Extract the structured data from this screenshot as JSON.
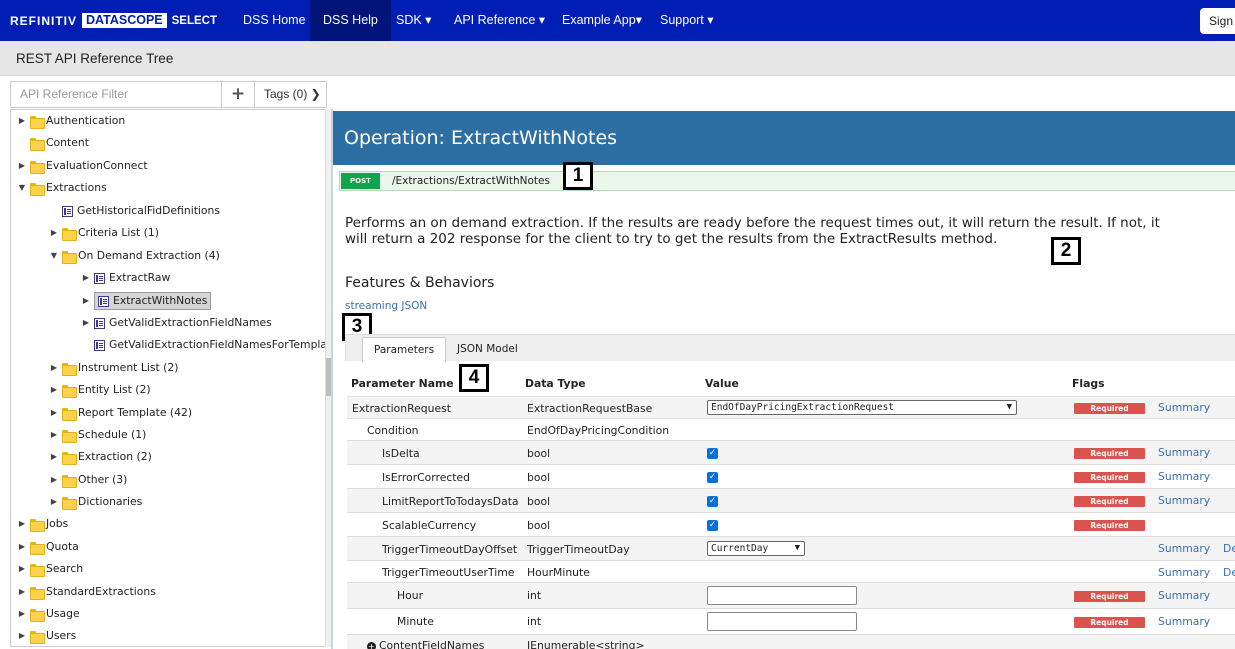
{
  "nav": {
    "logo": {
      "refinitiv": "REFINITIV",
      "datascope": "DATASCOPE",
      "select": "SELECT"
    },
    "items": [
      {
        "label": "DSS Home"
      },
      {
        "label": "DSS Help"
      },
      {
        "label": "SDK ▾"
      },
      {
        "label": "API Reference ▾"
      },
      {
        "label": "Example App▾"
      },
      {
        "label": "Support ▾"
      }
    ],
    "signin": "Sign"
  },
  "header": {
    "title": "REST API Reference Tree"
  },
  "filter": {
    "placeholder": "API Reference Filter",
    "plus": "+",
    "tags": "Tags (0) ❯"
  },
  "tree": [
    {
      "label": "Authentication",
      "arrow": "▶",
      "icon": "folder"
    },
    {
      "label": "Content",
      "arrow": "",
      "icon": "folder"
    },
    {
      "label": "EvaluationConnect",
      "arrow": "▶",
      "icon": "folder"
    },
    {
      "label": "Extractions",
      "arrow": "▼",
      "icon": "folder"
    },
    {
      "label": "GetHistoricalFidDefinitions",
      "arrow": "",
      "icon": "operation"
    },
    {
      "label": "Criteria List (1)",
      "arrow": "▶",
      "icon": "folder"
    },
    {
      "label": "On Demand Extraction (4)",
      "arrow": "▼",
      "icon": "folder"
    },
    {
      "label": "ExtractRaw",
      "arrow": "▶",
      "icon": "operation"
    },
    {
      "label": "ExtractWithNotes",
      "arrow": "▶",
      "icon": "operation"
    },
    {
      "label": "GetValidExtractionFieldNames",
      "arrow": "▶",
      "icon": "operation"
    },
    {
      "label": "GetValidExtractionFieldNamesForTemplat",
      "arrow": "",
      "icon": "operation"
    },
    {
      "label": "Instrument List (2)",
      "arrow": "▶",
      "icon": "folder"
    },
    {
      "label": "Entity List (2)",
      "arrow": "▶",
      "icon": "folder"
    },
    {
      "label": "Report Template (42)",
      "arrow": "▶",
      "icon": "folder"
    },
    {
      "label": "Schedule (1)",
      "arrow": "▶",
      "icon": "folder"
    },
    {
      "label": "Extraction (2)",
      "arrow": "▶",
      "icon": "folder"
    },
    {
      "label": "Other (3)",
      "arrow": "▶",
      "icon": "folder"
    },
    {
      "label": "Dictionaries",
      "arrow": "▶",
      "icon": "folder"
    },
    {
      "label": "Jobs",
      "arrow": "▶",
      "icon": "folder"
    },
    {
      "label": "Quota",
      "arrow": "▶",
      "icon": "folder"
    },
    {
      "label": "Search",
      "arrow": "▶",
      "icon": "folder"
    },
    {
      "label": "StandardExtractions",
      "arrow": "▶",
      "icon": "folder"
    },
    {
      "label": "Usage",
      "arrow": "▶",
      "icon": "folder"
    },
    {
      "label": "Users",
      "arrow": "▶",
      "icon": "folder"
    }
  ],
  "operation": {
    "title": "Operation: ExtractWithNotes",
    "method": "POST",
    "path": "/Extractions/ExtractWithNotes",
    "description_line1": "Performs an on demand extraction. If the results are ready before the request times out, it will return the result. If not, it",
    "description_line2": "will return a 202 response for the client to try to get the results from the ExtractResults method.",
    "features_title": "Features & Behaviors",
    "features_link": "streaming JSON"
  },
  "callouts": [
    "1",
    "2",
    "3",
    "4"
  ],
  "tabs": [
    {
      "label": "Parameters"
    },
    {
      "label": "JSON Model"
    }
  ],
  "table": {
    "headers": {
      "name": "Parameter Name",
      "type": "Data Type",
      "value": "Value",
      "flags": "Flags"
    },
    "rows": [
      {
        "name": "ExtractionRequest",
        "type": "ExtractionRequestBase",
        "value": "EndOfDayPricingExtractionRequest",
        "flag": "Required",
        "link": "Summary",
        "extra": ""
      },
      {
        "name": "Condition",
        "type": "EndOfDayPricingCondition",
        "value": "",
        "flag": "",
        "link": "",
        "extra": ""
      },
      {
        "name": "IsDelta",
        "type": "bool",
        "value": "checked",
        "flag": "Required",
        "link": "Summary",
        "extra": ""
      },
      {
        "name": "IsErrorCorrected",
        "type": "bool",
        "value": "checked",
        "flag": "Required",
        "link": "Summary",
        "extra": ""
      },
      {
        "name": "LimitReportToTodaysData",
        "type": "bool",
        "value": "checked",
        "flag": "Required",
        "link": "Summary",
        "extra": ""
      },
      {
        "name": "ScalableCurrency",
        "type": "bool",
        "value": "checked",
        "flag": "Required",
        "link": "",
        "extra": ""
      },
      {
        "name": "TriggerTimeoutDayOffset",
        "type": "TriggerTimeoutDay",
        "value": "CurrentDay",
        "flag": "",
        "link": "Summary",
        "extra": "De"
      },
      {
        "name": "TriggerTimeoutUserTime",
        "type": "HourMinute",
        "value": "",
        "flag": "",
        "link": "Summary",
        "extra": "De"
      },
      {
        "name": "Hour",
        "type": "int",
        "value": "",
        "flag": "Required",
        "link": "Summary",
        "extra": ""
      },
      {
        "name": "Minute",
        "type": "int",
        "value": "",
        "flag": "Required",
        "link": "Summary",
        "extra": ""
      },
      {
        "name": "ContentFieldNames",
        "type": "IEnumerable<string>",
        "value": "",
        "flag": "",
        "link": "",
        "extra": ""
      }
    ]
  },
  "colors": {
    "nav": "#001eb4",
    "opheader": "#2d6ea3",
    "post": "#10a54a",
    "required": "#d9534f",
    "link": "#3a6fb0"
  }
}
